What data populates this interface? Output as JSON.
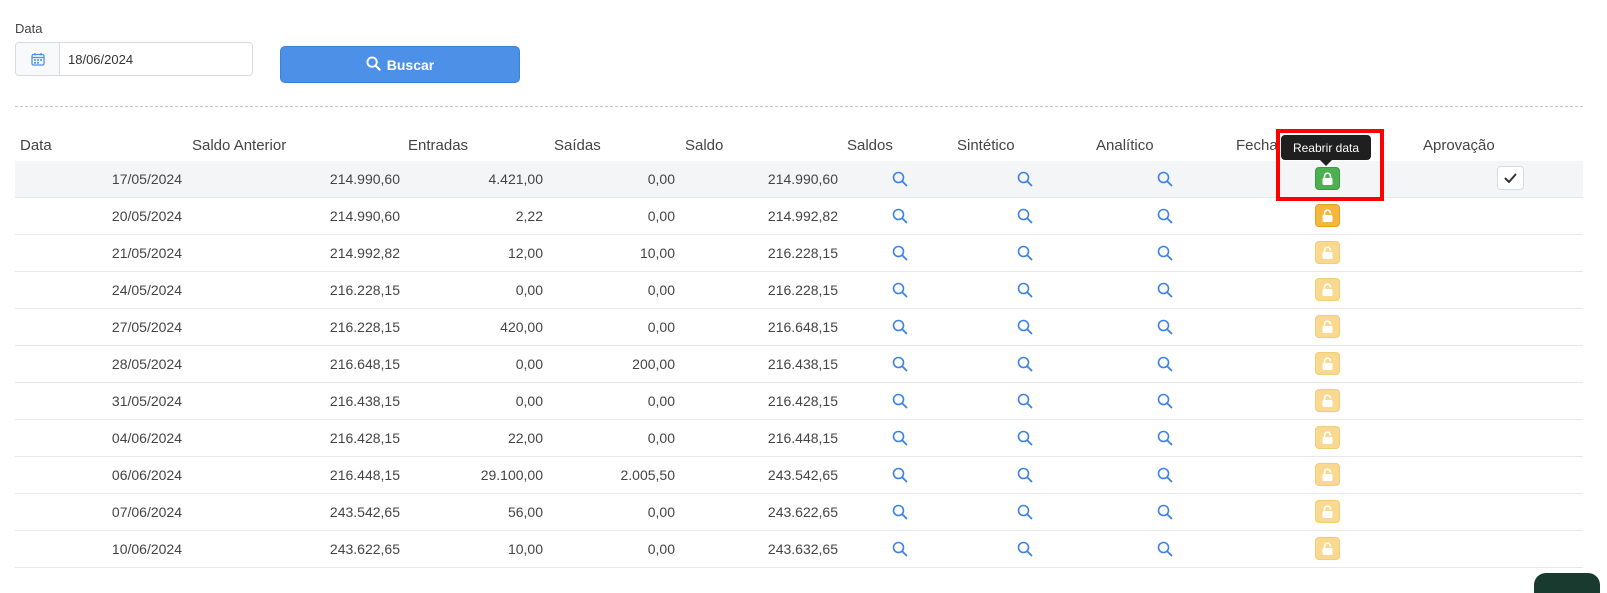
{
  "filter": {
    "date_label": "Data",
    "date_value": "18/06/2024",
    "calendar_icon": "calendar-icon",
    "search_label": "Buscar",
    "search_icon": "search-icon",
    "accent_color": "#4d90e8"
  },
  "table": {
    "headers": {
      "data": "Data",
      "saldo_anterior": "Saldo Anterior",
      "entradas": "Entradas",
      "saidas": "Saídas",
      "saldo": "Saldo",
      "saldos": "Saldos",
      "sintetico": "Sintético",
      "analitico": "Analítico",
      "fechamento": "Fecha",
      "aprovacao": "Aprovação"
    },
    "rows": [
      {
        "data": "17/05/2024",
        "saldo_anterior": "214.990,60",
        "entradas": "4.421,00",
        "saidas": "0,00",
        "saldo": "214.990,60",
        "lock": "closed"
      },
      {
        "data": "20/05/2024",
        "saldo_anterior": "214.990,60",
        "entradas": "2,22",
        "saidas": "0,00",
        "saldo": "214.992,82",
        "lock": "open"
      },
      {
        "data": "21/05/2024",
        "saldo_anterior": "214.992,82",
        "entradas": "12,00",
        "saidas": "10,00",
        "saldo": "216.228,15",
        "lock": "disabled"
      },
      {
        "data": "24/05/2024",
        "saldo_anterior": "216.228,15",
        "entradas": "0,00",
        "saidas": "0,00",
        "saldo": "216.228,15",
        "lock": "disabled"
      },
      {
        "data": "27/05/2024",
        "saldo_anterior": "216.228,15",
        "entradas": "420,00",
        "saidas": "0,00",
        "saldo": "216.648,15",
        "lock": "disabled"
      },
      {
        "data": "28/05/2024",
        "saldo_anterior": "216.648,15",
        "entradas": "0,00",
        "saidas": "200,00",
        "saldo": "216.438,15",
        "lock": "disabled"
      },
      {
        "data": "31/05/2024",
        "saldo_anterior": "216.438,15",
        "entradas": "0,00",
        "saidas": "0,00",
        "saldo": "216.428,15",
        "lock": "disabled"
      },
      {
        "data": "04/06/2024",
        "saldo_anterior": "216.428,15",
        "entradas": "22,00",
        "saidas": "0,00",
        "saldo": "216.448,15",
        "lock": "disabled"
      },
      {
        "data": "06/06/2024",
        "saldo_anterior": "216.448,15",
        "entradas": "29.100,00",
        "saidas": "2.005,50",
        "saldo": "243.542,65",
        "lock": "disabled"
      },
      {
        "data": "07/06/2024",
        "saldo_anterior": "243.542,65",
        "entradas": "56,00",
        "saidas": "0,00",
        "saldo": "243.622,65",
        "lock": "disabled"
      },
      {
        "data": "10/06/2024",
        "saldo_anterior": "243.622,65",
        "entradas": "10,00",
        "saidas": "0,00",
        "saldo": "243.632,65",
        "lock": "disabled"
      }
    ],
    "colors": {
      "lock_closed": "#4caf50",
      "lock_open": "#f5b63b",
      "lock_disabled": "#f9d88f",
      "search_icon": "#3b82e6"
    }
  },
  "tooltip": {
    "text": "Reabrir data"
  }
}
